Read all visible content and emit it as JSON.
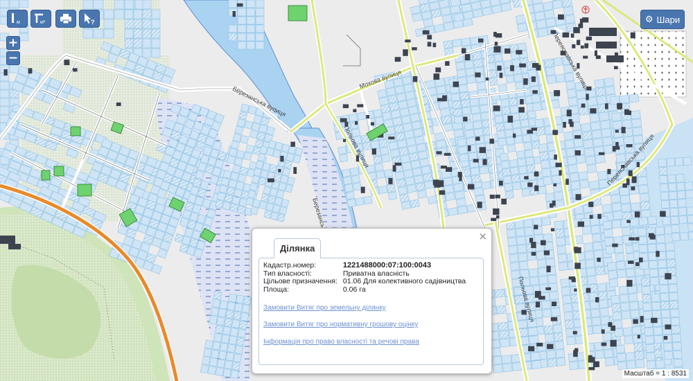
{
  "toolbar": {
    "measure_length_unit": "м",
    "measure_area_unit": "м²"
  },
  "layers_button": {
    "label": "Шари",
    "icon": "gear-icon"
  },
  "zoom": {
    "in_label": "+",
    "out_label": "−"
  },
  "streets": [
    "Березанська вулиця",
    "Мохова вулиця",
    "Польова вулиця",
    "Березанська вулиця",
    "Переяславська вулиця",
    "Переяславська вулиця",
    "Польова вулиця"
  ],
  "popup": {
    "tab_label": "Ділянка",
    "close_symbol": "×",
    "fields": [
      {
        "label": "Кадастр.номер:",
        "value": "1221488000:07:100:0043"
      },
      {
        "label": "Тип власності:",
        "value": "Приватна власність"
      },
      {
        "label": "Цільове призначення:",
        "value": "01.06 Для колективного садівництва"
      },
      {
        "label": "Площа:",
        "value": "0.06 га"
      }
    ],
    "links": [
      "Замовити Витяг про земельну ділянку",
      "Замовити Витяг про нормативну грошову оцінку",
      "Інформація про право власності та речові права"
    ]
  },
  "scale": {
    "text": "Масштаб = 1 : 8531"
  },
  "colors": {
    "parcel_fill": "#cfe4f5",
    "parcel_stroke": "#8ec3e6",
    "building": "#3d4450",
    "road_major": "#dde87a",
    "road_ring": "#e88a2a",
    "river": "#a9d3f1",
    "meadow": "#cfe4b8",
    "accent": "#4a76b0",
    "selected_parcel": "#6ed26e"
  }
}
